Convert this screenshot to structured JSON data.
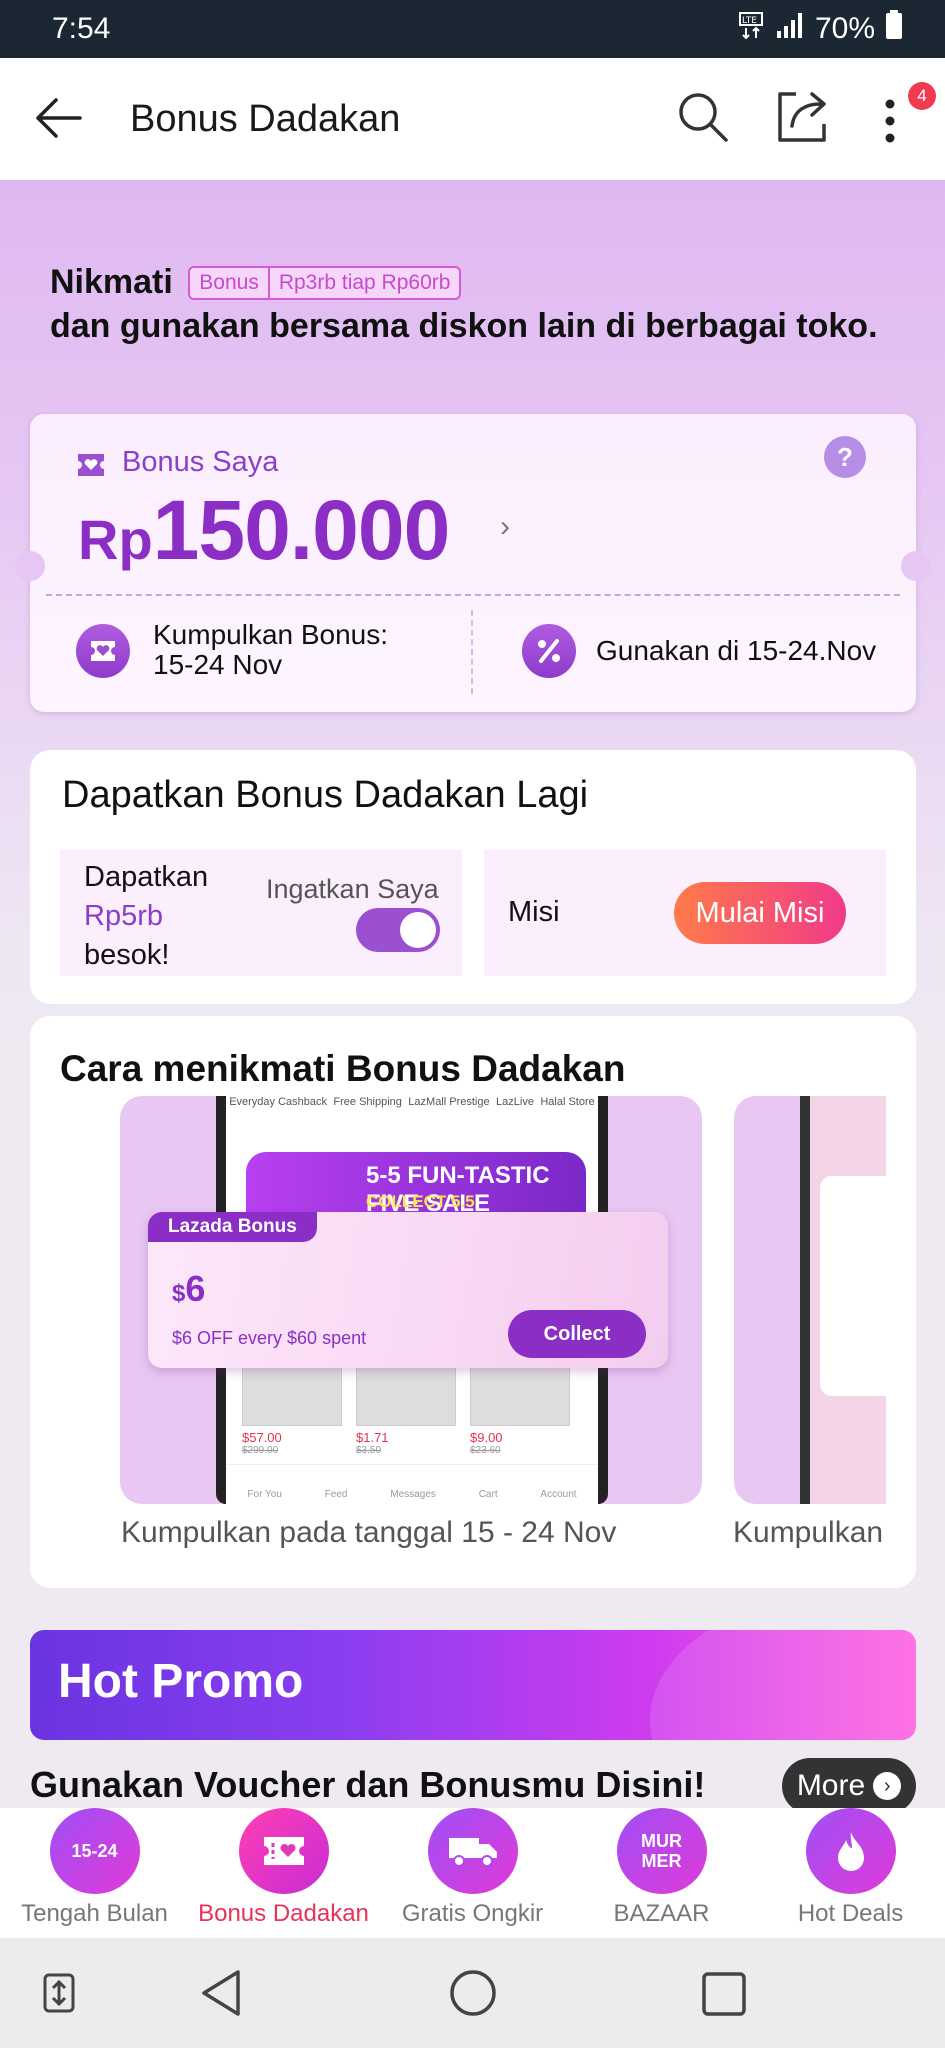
{
  "status_bar": {
    "time": "7:54",
    "network": "LTE",
    "battery": "70%"
  },
  "header": {
    "title": "Bonus Dadakan",
    "notification_count": "4"
  },
  "intro": {
    "lead": "Nikmati",
    "pill_tag": "Bonus",
    "pill_text": "Rp3rb tiap Rp60rb",
    "rest": "dan gunakan bersama diskon lain di berbagai toko."
  },
  "bonus_card": {
    "label": "Bonus Saya",
    "currency": "Rp",
    "amount": "150.000",
    "help": "?",
    "collect_label": "Kumpulkan Bonus: 15-24 Nov",
    "use_label": "Gunakan di 15-24.Nov"
  },
  "get_again": {
    "title": "Dapatkan Bonus Dadakan Lagi",
    "line1": "Dapatkan",
    "amount": "Rp5rb",
    "line3": "besok!",
    "remind_label": "Ingatkan Saya",
    "remind_on": true,
    "mission_label": "Misi",
    "mission_button": "Mulai Misi"
  },
  "how_to": {
    "title": "Cara menikmati Bonus Dadakan",
    "slides": [
      {
        "caption": "Kumpulkan pada tanggal 15 - 24 Nov",
        "tabs": [
          "Everyday Cashback",
          "Free Shipping",
          "LazMall Prestige",
          "LazLive",
          "Halal Store"
        ],
        "banner_title": "5-5 FUN-TASTIC FIVE SALE",
        "banner_sub": "COLLECT 5.5",
        "voucher_tag": "Lazada Bonus",
        "voucher_currency": "$",
        "voucher_amount": "6",
        "voucher_desc": "$6 OFF every $60 spent",
        "voucher_button": "Collect",
        "products": [
          {
            "price": "$57.00",
            "old": "$299.00"
          },
          {
            "price": "$1.71",
            "old": "$3.50"
          },
          {
            "price": "$9.00",
            "old": "$23.60"
          }
        ],
        "nav": [
          "For You",
          "Feed",
          "Messages",
          "Cart",
          "Account"
        ]
      },
      {
        "caption": "Kumpulkan"
      }
    ]
  },
  "hot_promo": {
    "banner_title": "Hot Promo",
    "section_title": "Gunakan Voucher dan Bonusmu Disini!",
    "more_label": "More"
  },
  "bottom_tabs": [
    {
      "label": "Tengah Bulan",
      "icon": "calendar-icon",
      "icon_text": "15-24",
      "active": false
    },
    {
      "label": "Bonus Dadakan",
      "icon": "ticket-icon",
      "icon_text": "",
      "active": true
    },
    {
      "label": "Gratis Ongkir",
      "icon": "truck-icon",
      "icon_text": "",
      "active": false
    },
    {
      "label": "BAZAAR",
      "icon": "bazaar-icon",
      "icon_text": "MUR MER",
      "active": false
    },
    {
      "label": "Hot Deals",
      "icon": "flame-icon",
      "icon_text": "",
      "active": false
    }
  ],
  "colors": {
    "accent": "#8a3fc6",
    "active_tab": "#e8325a",
    "mission_start": "#ff7b4a",
    "mission_end": "#f03a88"
  }
}
